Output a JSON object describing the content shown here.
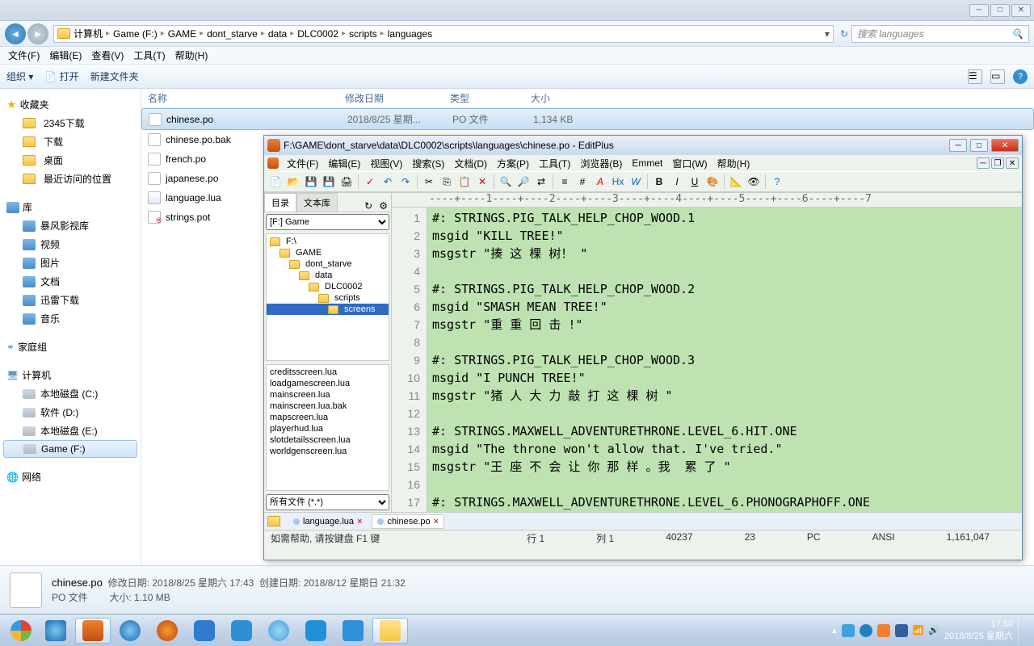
{
  "explorer": {
    "breadcrumb": [
      "计算机",
      "Game (F:)",
      "GAME",
      "dont_starve",
      "data",
      "DLC0002",
      "scripts",
      "languages"
    ],
    "search_placeholder": "搜索 languages",
    "menu": [
      "文件(F)",
      "编辑(E)",
      "查看(V)",
      "工具(T)",
      "帮助(H)"
    ],
    "toolbar": {
      "organize": "组织 ▾",
      "open": "打开",
      "new_folder": "新建文件夹"
    },
    "columns": {
      "name": "名称",
      "date": "修改日期",
      "type": "类型",
      "size": "大小"
    },
    "nav": {
      "favorites": "收藏夹",
      "fav_items": [
        "2345下载",
        "下载",
        "桌面",
        "最近访问的位置"
      ],
      "libraries": "库",
      "lib_items": [
        "暴风影视库",
        "视频",
        "图片",
        "文档",
        "迅雷下载",
        "音乐"
      ],
      "homegroup": "家庭组",
      "computer": "计算机",
      "drives": [
        "本地磁盘 (C:)",
        "软件 (D:)",
        "本地磁盘 (E:)",
        "Game (F:)"
      ],
      "network": "网络"
    },
    "files": [
      {
        "name": "chinese.po",
        "date": "2018/8/25 星期...",
        "type": "PO 文件",
        "size": "1,134 KB",
        "sel": true
      },
      {
        "name": "chinese.po.bak"
      },
      {
        "name": "french.po"
      },
      {
        "name": "japanese.po"
      },
      {
        "name": "language.lua",
        "cls": "lua"
      },
      {
        "name": "strings.pot",
        "cls": "pot"
      }
    ],
    "details": {
      "name": "chinese.po",
      "modified_label": "修改日期:",
      "modified": "2018/8/25 星期六 17:43",
      "created_label": "创建日期:",
      "created": "2018/8/12 星期日 21:32",
      "type": "PO 文件",
      "size_label": "大小:",
      "size": "1.10 MB"
    }
  },
  "editplus": {
    "title": "F:\\GAME\\dont_starve\\data\\DLC0002\\scripts\\languages\\chinese.po - EditPlus",
    "menu": [
      "文件(F)",
      "编辑(E)",
      "视图(V)",
      "搜索(S)",
      "文档(D)",
      "方案(P)",
      "工具(T)",
      "浏览器(B)",
      "Emmet",
      "窗口(W)",
      "帮助(H)"
    ],
    "side_tabs": {
      "dir": "目录",
      "lib": "文本库"
    },
    "drive": "[F:] Game",
    "tree": [
      "F:\\",
      "GAME",
      "dont_starve",
      "data",
      "DLC0002",
      "scripts",
      "screens"
    ],
    "tree_sel": 6,
    "files": [
      "creditsscreen.lua",
      "loadgamescreen.lua",
      "mainscreen.lua",
      "mainscreen.lua.bak",
      "mapscreen.lua",
      "playerhud.lua",
      "slotdetailsscreen.lua",
      "worldgenscreen.lua"
    ],
    "filter": "所有文件 (*.*)",
    "ruler": "----+----1----+----2----+----3----+----4----+----5----+----6----+----7",
    "lines": [
      "#: STRINGS.PIG_TALK_HELP_CHOP_WOOD.1",
      "msgid \"KILL TREE!\"",
      "msgstr \"揍 这 棵 树！ \"",
      "",
      "#: STRINGS.PIG_TALK_HELP_CHOP_WOOD.2",
      "msgid \"SMASH MEAN TREE!\"",
      "msgstr \"重 重 回 击 !\"",
      "",
      "#: STRINGS.PIG_TALK_HELP_CHOP_WOOD.3",
      "msgid \"I PUNCH TREE!\"",
      "msgstr \"猪 人 大 力 敲 打 这 棵 树 \"",
      "",
      "#: STRINGS.MAXWELL_ADVENTURETHRONE.LEVEL_6.HIT.ONE",
      "msgid \"The throne won't allow that. I've tried.\"",
      "msgstr \"王 座 不 会 让 你 那 样 。我  累 了 \"",
      "",
      "#: STRINGS.MAXWELL_ADVENTURETHRONE.LEVEL_6.PHONOGRAPHOFF.ONE"
    ],
    "doctabs": [
      {
        "name": "language.lua",
        "active": false
      },
      {
        "name": "chinese.po",
        "active": true
      }
    ],
    "status": {
      "help": "如需帮助, 请按键盘 F1 键",
      "line": "行 1",
      "col": "列 1",
      "v1": "40237",
      "v2": "23",
      "pc": "PC",
      "enc": "ANSI",
      "bytes": "1,161,047"
    }
  },
  "taskbar": {
    "tray_icons": 7,
    "time": "17:50",
    "date": "2018/8/25 星期六"
  }
}
